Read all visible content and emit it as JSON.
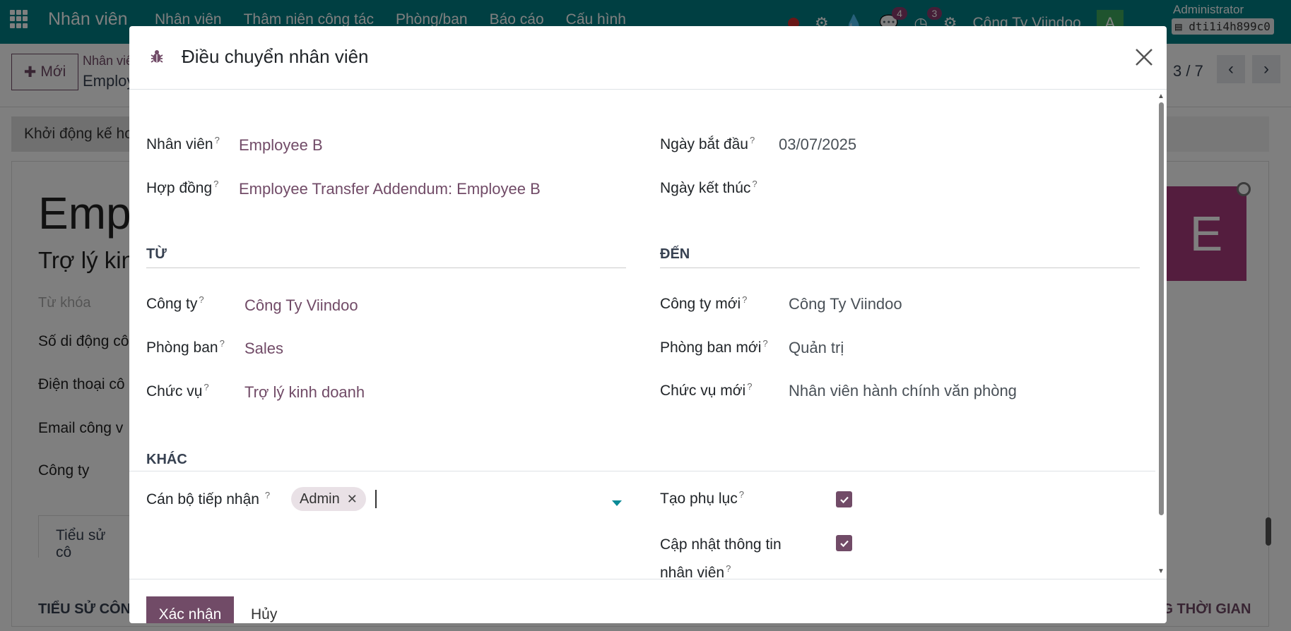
{
  "navbar": {
    "app_name": "Nhân viên",
    "menu": [
      "Nhân viên",
      "Thâm niên công tác",
      "Phòng/ban",
      "Báo cáo",
      "Cấu hình"
    ],
    "messages_badge": "4",
    "activities_badge": "3",
    "company": "Công Ty Viindoo",
    "avatar_letter": "A",
    "user": "Administrator",
    "db": "dti1i4h899c0",
    "color": "#017e84"
  },
  "background": {
    "new_button": "Mới",
    "breadcrumb_parent": "Nhân viê",
    "breadcrumb_current": "Employ",
    "pager": "3 / 7",
    "start_button": "Khởi động kế ho",
    "employee_name": "Emp",
    "job_title": "Trợ lý kin",
    "tags_placeholder": "Từ khóa",
    "labels": [
      "Số di động cô",
      "Điện thoại cô",
      "Email công v",
      "Công ty"
    ],
    "tab": "Tiểu sử cô",
    "section_left": "TIỂU SỬ CÔNG",
    "section_right": "NG THỜI GIAN",
    "avatar_letter": "E"
  },
  "modal": {
    "title": "Điều chuyển nhân viên",
    "fields": {
      "employee": {
        "label": "Nhân viên",
        "value": "Employee B"
      },
      "contract": {
        "label": "Hợp đồng",
        "value": "Employee Transfer Addendum: Employee B"
      },
      "start_date": {
        "label": "Ngày bắt đầu",
        "value": "03/07/2025"
      },
      "end_date": {
        "label": "Ngày kết thúc",
        "value": ""
      }
    },
    "from": {
      "heading": "TỪ",
      "company": {
        "label": "Công ty",
        "value": "Công Ty Viindoo"
      },
      "department": {
        "label": "Phòng ban",
        "value": "Sales"
      },
      "job": {
        "label": "Chức vụ",
        "value": "Trợ lý kinh doanh"
      }
    },
    "to": {
      "heading": "ĐẾN",
      "company": {
        "label": "Công ty mới",
        "value": "Công Ty Viindoo"
      },
      "department": {
        "label": "Phòng ban mới",
        "value": "Quản trị"
      },
      "job": {
        "label": "Chức vụ mới",
        "value": "Nhân viên hành chính văn phòng"
      }
    },
    "other": {
      "heading": "KHÁC",
      "receiver": {
        "label": "Cán bộ tiếp nhận",
        "tags": [
          "Admin"
        ]
      },
      "create_addendum": {
        "label": "Tạo phụ lục",
        "checked": true
      },
      "update_info": {
        "label_line1": "Cập nhật thông tin",
        "label_line2": "nhân viên",
        "checked": true
      }
    },
    "help_mark": "?",
    "confirm_button": "Xác nhận",
    "cancel_button": "Hủy",
    "accent": "#714b67"
  }
}
